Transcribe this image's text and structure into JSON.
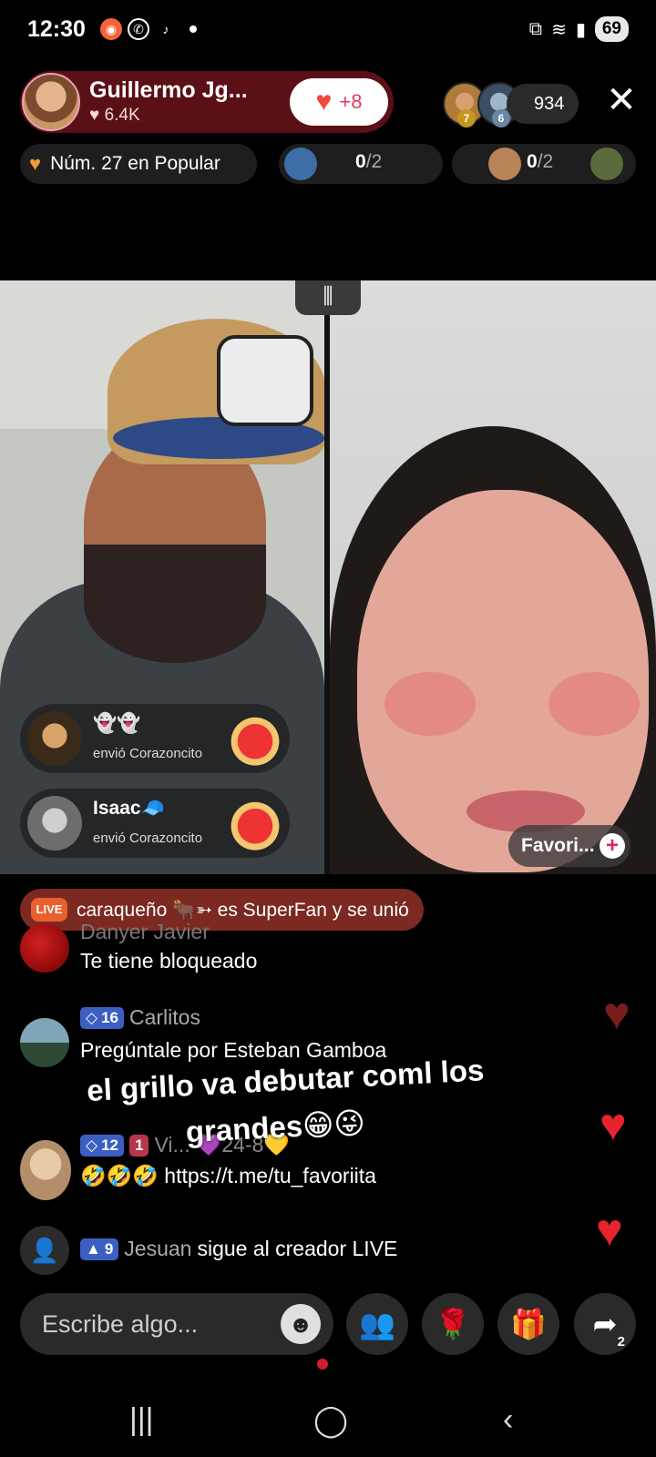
{
  "status_bar": {
    "time": "12:30",
    "battery": "69",
    "app_icons": [
      "app-notification-icon",
      "whatsapp-icon",
      "tiktok-icon"
    ],
    "right_icons": [
      "cast-icon",
      "wifi-icon",
      "signal-icon"
    ]
  },
  "host": {
    "name": "Guillermo Jg...",
    "likes": "6.4K",
    "follow_count": "+8"
  },
  "viewers": {
    "count": "934",
    "top_ranks": [
      "7",
      "6"
    ]
  },
  "badges": {
    "rank_text": "Núm. 27 en Popular",
    "goal1": {
      "current": "0",
      "total": "/2"
    },
    "goal2": {
      "current": "0",
      "total": "/2"
    }
  },
  "gifts": [
    {
      "user": "👻👻",
      "action": "envió Corazoncito"
    },
    {
      "user": "Isaac🧢",
      "action": "envió Corazoncito"
    }
  ],
  "favorite_label": "Favori...",
  "superfan_text": "caraqueño 🐂➳ es SuperFan y se unió",
  "chat": [
    {
      "user": "Danyer Javier",
      "text": "Te tiene bloqueado"
    },
    {
      "level": "16",
      "user": "Carlitos",
      "text": "Pregúntale por Esteban Gamboa"
    },
    {
      "level": "12",
      "level2": "1",
      "user": "Vi...",
      "extra": "💜24-8💛",
      "text": "🤣🤣🤣 https://t.me/tu_favoriita"
    },
    {
      "level": "9",
      "user": "Jesuan",
      "text": "sigue al creador LIVE"
    }
  ],
  "overlay_caption": {
    "line1": "el grillo va debutar coml los",
    "line2": "grandes😁😜"
  },
  "composer": {
    "placeholder": "Escribe algo...",
    "share_count": "2"
  },
  "colors": {
    "accent_red": "#e5395f",
    "heart": "#f2473f",
    "superfan_bg": "#7c2922"
  }
}
